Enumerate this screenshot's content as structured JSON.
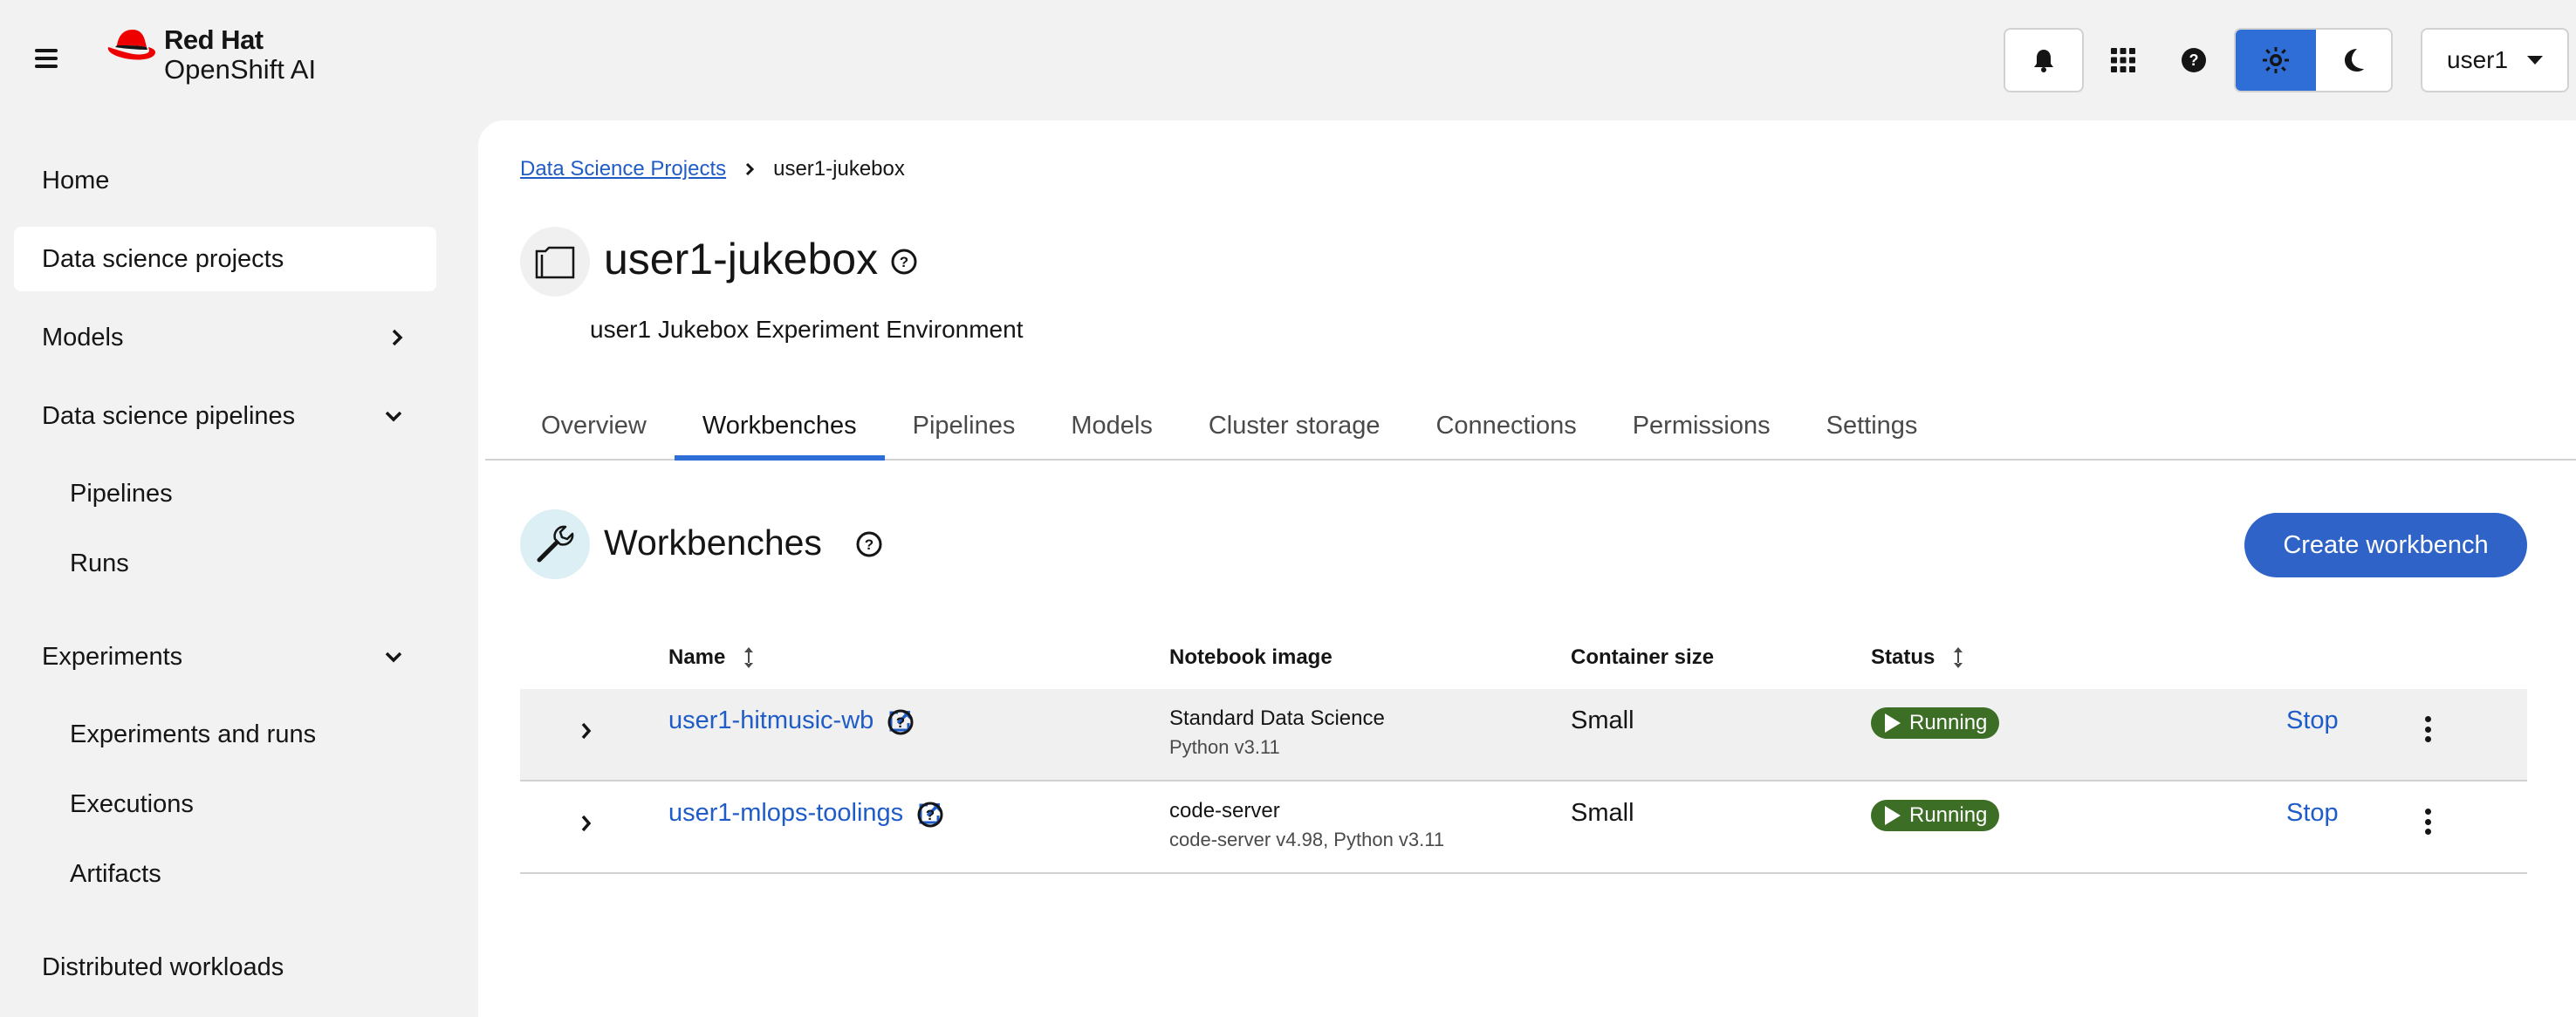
{
  "header": {
    "logo_brand": "Red Hat",
    "logo_product": "OpenShift AI",
    "user": "user1",
    "icons": [
      "hamburger-icon",
      "bell-icon",
      "app-grid-icon",
      "help-icon",
      "sun-icon",
      "moon-icon"
    ]
  },
  "sidebar": {
    "home": "Home",
    "data_science_projects": "Data science projects",
    "models": "Models",
    "pipelines_group": "Data science pipelines",
    "pipelines": "Pipelines",
    "runs": "Runs",
    "experiments_group": "Experiments",
    "experiments_and_runs": "Experiments and runs",
    "executions": "Executions",
    "artifacts": "Artifacts",
    "distributed_workloads": "Distributed workloads"
  },
  "breadcrumb": {
    "root": "Data Science Projects",
    "current": "user1-jukebox"
  },
  "project": {
    "title": "user1-jukebox",
    "description": "user1 Jukebox Experiment Environment"
  },
  "tabs": [
    "Overview",
    "Workbenches",
    "Pipelines",
    "Models",
    "Cluster storage",
    "Connections",
    "Permissions",
    "Settings"
  ],
  "active_tab": "Workbenches",
  "workbenches": {
    "title": "Workbenches",
    "create_label": "Create workbench",
    "columns": {
      "name": "Name",
      "image": "Notebook image",
      "size": "Container size",
      "status": "Status"
    },
    "rows": [
      {
        "name": "user1-hitmusic-wb",
        "image": "Standard Data Science",
        "image_version": "Python v3.11",
        "size": "Small",
        "status": "Running",
        "action": "Stop"
      },
      {
        "name": "user1-mlops-toolings",
        "image": "code-server",
        "image_version": "code-server v4.98, Python v3.11",
        "size": "Small",
        "status": "Running",
        "action": "Stop"
      }
    ]
  },
  "colors": {
    "accent": "#2f63c8",
    "link": "#1f5cc7",
    "running": "#3c6e25",
    "page_bg": "#f2f2f2"
  }
}
